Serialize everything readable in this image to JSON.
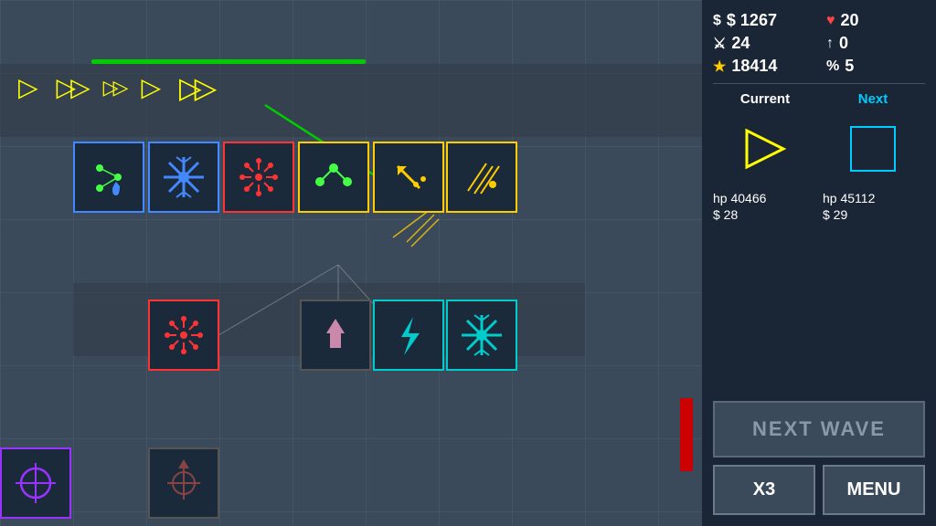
{
  "stats": {
    "money": "$ 1267",
    "hearts": "20",
    "sword": "24",
    "arrow_up": "0",
    "star": "18414",
    "percent": "5",
    "money_icon": "💲",
    "heart_icon": "♥",
    "sword_icon": "⚔",
    "star_icon": "★",
    "percent_icon": "%"
  },
  "wave": {
    "current_label": "Current",
    "next_label": "Next",
    "current_hp": "hp 40466",
    "current_money": "$ 28",
    "next_hp": "hp 45112",
    "next_money": "$ 29"
  },
  "buttons": {
    "next_wave": "NEXT WAVE",
    "x3": "X3",
    "menu": "MENU"
  },
  "enemies": [
    {
      "type": "single",
      "label": "▷"
    },
    {
      "type": "double",
      "label": "▷▷"
    },
    {
      "type": "fast",
      "label": "▷▷"
    },
    {
      "type": "single",
      "label": "▷"
    },
    {
      "type": "double-fast",
      "label": "▷▷"
    }
  ]
}
